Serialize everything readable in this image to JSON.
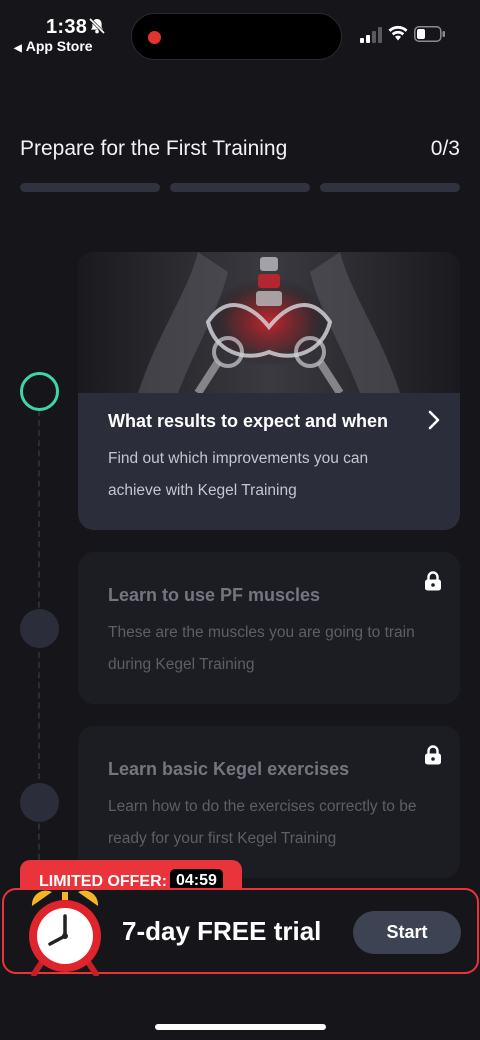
{
  "status_bar": {
    "time": "1:38",
    "back_label": "App Store",
    "icons": [
      "bell-slash-icon",
      "signal-icon",
      "wifi-icon",
      "battery-icon"
    ]
  },
  "header": {
    "title": "Prepare for the First Training",
    "progress_text": "0/3",
    "progress_segments": 3,
    "progress_completed": 0
  },
  "steps": [
    {
      "title": "What results to expect and when",
      "description": "Find out which improvements you can achieve with Kegel Training",
      "state": "active",
      "icon": "chevron-right-icon"
    },
    {
      "title": "Learn to use PF muscles",
      "description": "These are the muscles you are going to train during Kegel Training",
      "state": "locked",
      "icon": "lock-icon"
    },
    {
      "title": "Learn basic Kegel exercises",
      "description": "Learn how to do the exercises correctly to be ready for your first Kegel Training",
      "state": "locked",
      "icon": "lock-icon"
    }
  ],
  "offer": {
    "label": "LIMITED OFFER:",
    "timer": "04:59",
    "trial_text": "7-day FREE trial",
    "button_label": "Start",
    "icon": "alarm-clock-icon"
  },
  "colors": {
    "background": "#16161a",
    "card_active": "#2b2e3a",
    "card_locked": "#1c1d22",
    "accent_green": "#3fd6a6",
    "offer_red": "#e8343a",
    "button": "#3d4352"
  }
}
